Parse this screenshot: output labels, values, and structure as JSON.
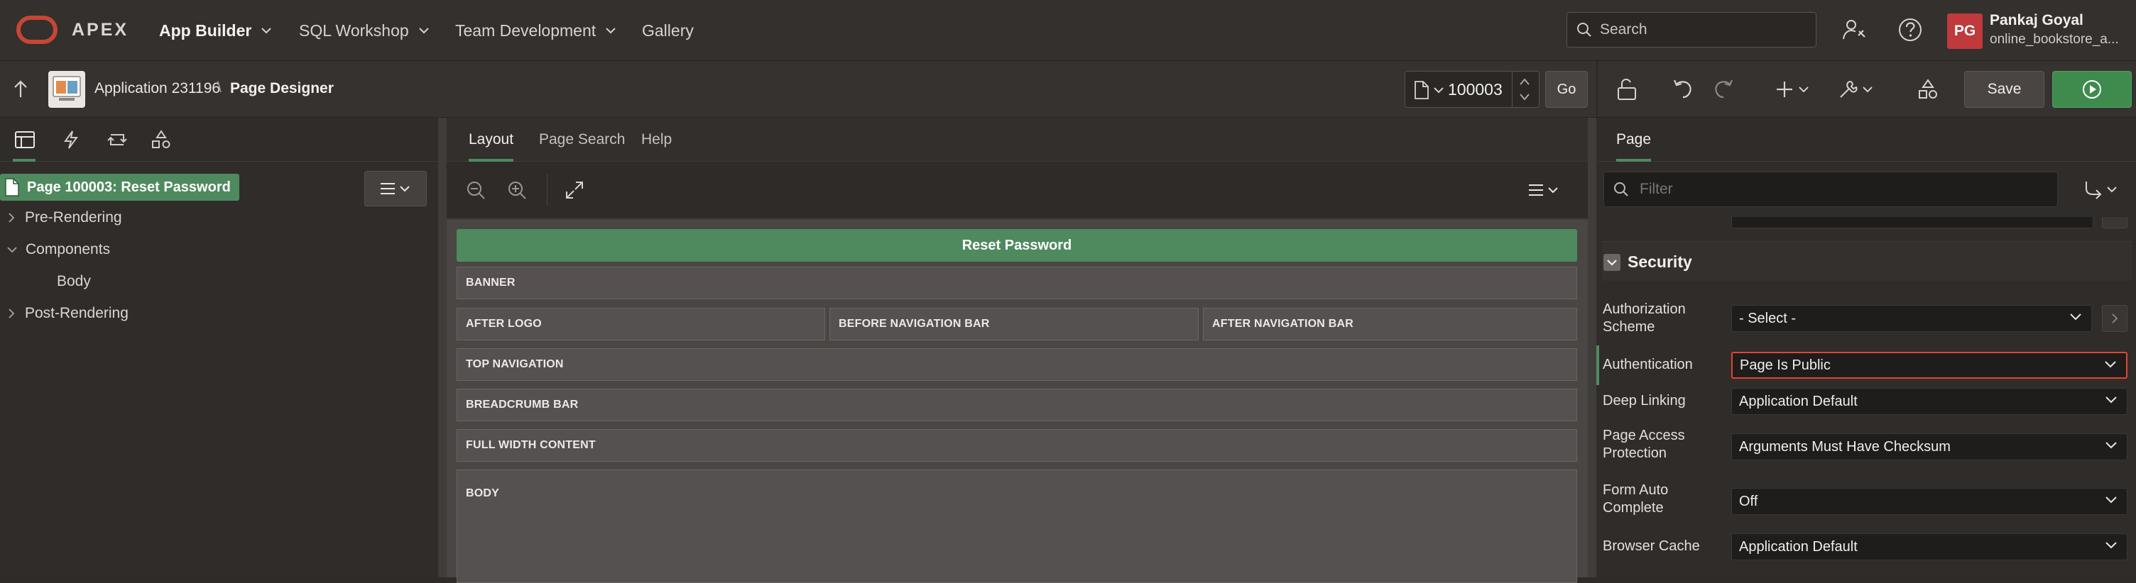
{
  "topbar": {
    "brand": "APEX",
    "nav": [
      {
        "label": "App Builder"
      },
      {
        "label": "SQL Workshop"
      },
      {
        "label": "Team Development"
      },
      {
        "label": "Gallery"
      }
    ],
    "search_placeholder": "Search",
    "user": {
      "initials": "PG",
      "name": "Pankaj Goyal",
      "workspace": "online_bookstore_a..."
    }
  },
  "toolbar": {
    "app_label": "Application 231196",
    "separator": "\\",
    "designer_label": "Page Designer",
    "page_number": "100003",
    "go_label": "Go",
    "save_label": "Save"
  },
  "left": {
    "page_node": "Page 100003: Reset Password",
    "tree": [
      "Pre-Rendering",
      "Components",
      "Body",
      "Post-Rendering"
    ]
  },
  "center": {
    "tabs": [
      "Layout",
      "Page Search",
      "Help"
    ],
    "page_title_bar": "Reset Password",
    "regions": {
      "banner": "BANNER",
      "after_logo": "AFTER LOGO",
      "before_nav": "BEFORE NAVIGATION BAR",
      "after_nav": "AFTER NAVIGATION BAR",
      "top_nav": "TOP NAVIGATION",
      "breadcrumb": "BREADCRUMB BAR",
      "full_width": "FULL WIDTH CONTENT",
      "body": "BODY"
    }
  },
  "right": {
    "tab": "Page",
    "filter_placeholder": "Filter",
    "section_title": "Security",
    "props": [
      {
        "label": "Authorization Scheme",
        "value": "- Select -"
      },
      {
        "label": "Authentication",
        "value": "Page Is Public"
      },
      {
        "label": "Deep Linking",
        "value": "Application Default"
      },
      {
        "label": "Page Access Protection",
        "value": "Arguments Must Have Checksum"
      },
      {
        "label": "Form Auto Complete",
        "value": "Off"
      },
      {
        "label": "Browser Cache",
        "value": "Application Default"
      }
    ]
  },
  "colors": {
    "accent_green": "#4f8a5f",
    "run_green": "#3f8b4e",
    "highlight_red": "#e0462f",
    "avatar_red": "#c0393b",
    "oracle_red": "#c74634"
  }
}
